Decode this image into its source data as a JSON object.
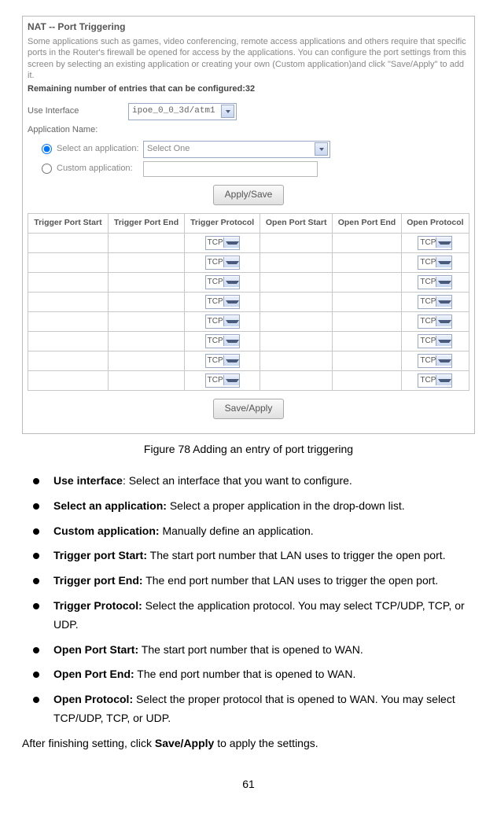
{
  "screenshot": {
    "title": "NAT -- Port Triggering",
    "description": "Some applications such as games, video conferencing, remote access applications and others require that specific ports in the Router's firewall be opened for access by the applications. You can configure the port settings from this screen by selecting an existing application or creating your own (Custom application)and click \"Save/Apply\" to add it.",
    "remaining": "Remaining number of entries that can be configured:32",
    "useInterfaceLabel": "Use Interface",
    "useInterfaceValue": "ipoe_0_0_3d/atm1",
    "appNameLabel": "Application Name:",
    "selectAppLabel": "Select an application:",
    "selectAppValue": "Select One",
    "customAppLabel": "Custom application:",
    "applySaveBtn": "Apply/Save",
    "saveApplyBtn": "Save/Apply",
    "headers": [
      "Trigger Port Start",
      "Trigger Port End",
      "Trigger Protocol",
      "Open Port Start",
      "Open Port End",
      "Open Protocol"
    ],
    "protoVal": "TCP"
  },
  "caption": "Figure 78 Adding an entry of port triggering",
  "bullets": [
    {
      "b": "Use interface",
      "sep": ": ",
      "t": "Select an interface that you want to configure."
    },
    {
      "b": "Select an application:",
      "sep": " ",
      "t": "Select a proper application in the drop-down list."
    },
    {
      "b": "Custom application:",
      "sep": " ",
      "t": "Manually define an application."
    },
    {
      "b": "Trigger port Start:",
      "sep": " ",
      "t": "The start port number that LAN uses to trigger the open port."
    },
    {
      "b": "Trigger port End:",
      "sep": " ",
      "t": "The end port number that LAN uses to trigger the open port."
    },
    {
      "b": "Trigger Protocol:",
      "sep": " ",
      "t": "Select the application protocol. You may select TCP/UDP, TCP, or UDP."
    },
    {
      "b": "Open Port Start:",
      "sep": " ",
      "t": "The start port number that is opened to WAN."
    },
    {
      "b": "Open Port End:",
      "sep": " ",
      "t": "The end port number that is opened to WAN."
    },
    {
      "b": "Open Protocol:",
      "sep": " ",
      "t": "Select the proper protocol that is opened to WAN. You may select TCP/UDP, TCP, or UDP."
    }
  ],
  "afterPrefix": "After finishing setting, click ",
  "afterBold": "Save/Apply",
  "afterSuffix": " to apply the settings.",
  "pageNumber": "61"
}
